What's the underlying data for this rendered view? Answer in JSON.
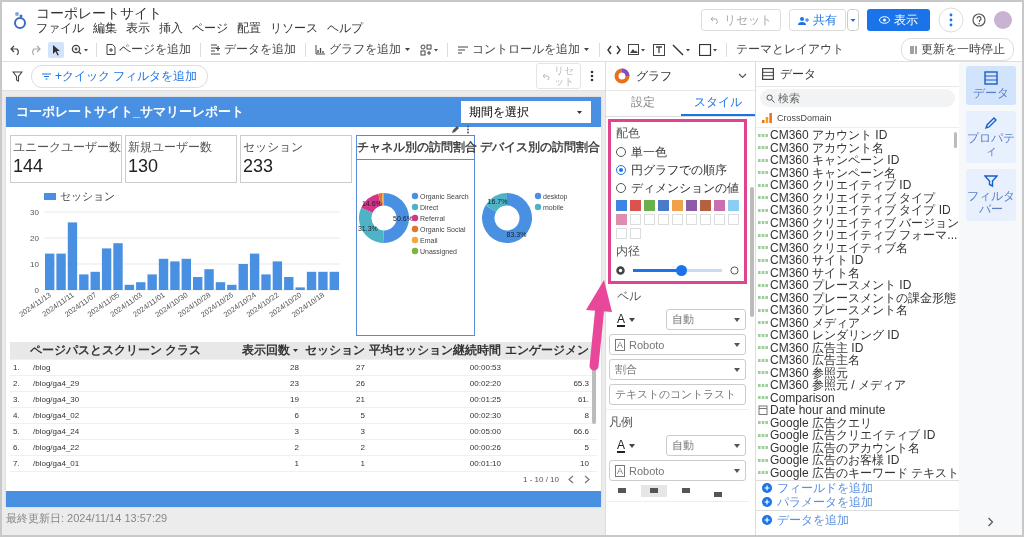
{
  "header": {
    "title": "コーポレートサイト",
    "menu": [
      "ファイル",
      "編集",
      "表示",
      "挿入",
      "ページ",
      "配置",
      "リソース",
      "ヘルプ"
    ],
    "reset": {
      "label": "リセット",
      "disabled": true
    },
    "share": "共有",
    "view": "表示"
  },
  "toolbar": {
    "pointer_selected": true,
    "add_page": "ページを追加",
    "add_data": "データを追加",
    "add_chart": "グラフを追加",
    "add_control": "コントロールを追加",
    "theme": "テーマとレイアウト",
    "pause": "更新を一時停止"
  },
  "filter_bar": {
    "quick_filter": "+クイック フィルタを追加",
    "reset": {
      "label": "リセット",
      "disabled": true
    }
  },
  "report": {
    "title": "コーポレートサイト_サマリーレポート",
    "date_picker": "期間を選択",
    "scorecards": [
      {
        "label": "ユニークユーザー数",
        "value": "144"
      },
      {
        "label": "新規ユーザー数",
        "value": "130"
      },
      {
        "label": "セッション",
        "value": "233"
      }
    ],
    "bar_chart": {
      "chart_data": {
        "type": "bar",
        "legend": "top",
        "ylim": [
          0,
          30
        ],
        "yticks": [
          0,
          10,
          20,
          30
        ],
        "categories": [
          "2024/11/13",
          null,
          "2024/11/11",
          null,
          "2024/11/07",
          null,
          "2024/11/05",
          null,
          "2024/11/03",
          null,
          "2024/11/01",
          null,
          "2024/10/30",
          null,
          "2024/10/28",
          null,
          "2024/10/26",
          null,
          "2024/10/24",
          null,
          "2024/10/22",
          null,
          "2024/10/20",
          null,
          "2024/10/18",
          null
        ],
        "series": [
          {
            "name": "セッション",
            "color": "#4a90e2",
            "values": [
              14,
              14,
              26,
              6,
              7,
              16,
              18,
              2,
              3,
              6,
              12,
              11,
              12,
              5,
              8,
              3,
              2,
              10,
              14,
              6,
              11,
              5,
              1,
              7,
              7,
              7
            ]
          }
        ]
      }
    },
    "donuts": [
      {
        "selected": true,
        "chart_data": {
          "type": "donut",
          "legend": "right",
          "title": "チャネル別の訪問割合",
          "categories": [
            "Organic Search",
            "Direct",
            "Referral",
            "Organic Social",
            "Email",
            "Unassigned"
          ],
          "values": [
            50.6,
            31.3,
            14.6,
            2.4,
            0.8,
            0.5
          ],
          "colors": [
            "#4a90e2",
            "#4fb3c8",
            "#d6338a",
            "#e0762c",
            "#f2a93b",
            "#7cb342"
          ],
          "value_labels": [
            "50.6%",
            "31.3%",
            "14.6%",
            null,
            null,
            null
          ]
        }
      },
      {
        "selected": false,
        "chart_data": {
          "type": "donut",
          "legend": "right",
          "title": "デバイス別の訪問割合",
          "categories": [
            "desktop",
            "mobile"
          ],
          "values": [
            83.3,
            16.7
          ],
          "colors": [
            "#4a90e2",
            "#4fb3c8"
          ],
          "value_labels": [
            "83.3%",
            "16.7%"
          ]
        }
      }
    ],
    "table": {
      "columns": [
        {
          "label": "ページパスとスクリーン クラス",
          "sorted": false
        },
        {
          "label": "表示回数",
          "sorted": true
        },
        {
          "label": "セッション",
          "sorted": false
        },
        {
          "label": "平均セッション継続時間",
          "sorted": false
        },
        {
          "label": "エンゲージメン",
          "sorted": false
        }
      ],
      "rows": [
        {
          "index": "1.",
          "cells": [
            "/blog",
            "28",
            "27",
            "00:00:53"
          ]
        },
        {
          "index": "2.",
          "cells": [
            "/blog/ga4_29",
            "23",
            "26",
            "00:02:20",
            "65.3"
          ]
        },
        {
          "index": "3.",
          "cells": [
            "/blog/ga4_30",
            "19",
            "21",
            "00:01:25",
            "61."
          ]
        },
        {
          "index": "4.",
          "cells": [
            "/blog/ga4_02",
            "6",
            "5",
            "00:02:30",
            "8"
          ]
        },
        {
          "index": "5.",
          "cells": [
            "/blog/ga4_24",
            "3",
            "3",
            "00:05:00",
            "66.6"
          ]
        },
        {
          "index": "6.",
          "cells": [
            "/blog/ga4_22",
            "2",
            "2",
            "00:00:26",
            "5"
          ]
        },
        {
          "index": "7.",
          "cells": [
            "/blog/ga4_01",
            "1",
            "1",
            "00:01:10",
            "10"
          ]
        }
      ],
      "pagination": "1 - 10 / 10"
    },
    "updated": "最終更新日: 2024/11/14 13:57:29"
  },
  "panel": {
    "title": "グラフ",
    "tabs": [
      {
        "label": "設定",
        "selected": false
      },
      {
        "label": "スタイル",
        "selected": true
      }
    ],
    "color_section": {
      "heading": "配色",
      "options": [
        {
          "label": "単一色",
          "selected": false
        },
        {
          "label": "円グラフでの順序",
          "selected": true
        },
        {
          "label": "ディメンションの値",
          "selected": false
        }
      ],
      "swatches": [
        {
          "kind": "color",
          "color": "#3d85e0"
        },
        {
          "kind": "color",
          "color": "#d9534f"
        },
        {
          "kind": "color",
          "color": "#6ab04c"
        },
        {
          "kind": "color",
          "color": "#4a7bc8"
        },
        {
          "kind": "color",
          "color": "#f0a24a"
        },
        {
          "kind": "color",
          "color": "#8e5ba8"
        },
        {
          "kind": "color",
          "color": "#b5613f"
        },
        {
          "kind": "color",
          "color": "#c96faf"
        },
        {
          "kind": "color",
          "color": "#8ccdf5"
        },
        {
          "kind": "color",
          "color": "#e08bb0"
        },
        {
          "kind": "empty"
        },
        {
          "kind": "empty"
        },
        {
          "kind": "empty"
        },
        {
          "kind": "empty"
        },
        {
          "kind": "empty"
        },
        {
          "kind": "empty"
        },
        {
          "kind": "empty"
        },
        {
          "kind": "empty"
        },
        {
          "kind": "empty"
        },
        {
          "kind": "empty"
        }
      ],
      "inner_radius": {
        "label": "内径",
        "level": 0.55
      }
    },
    "label_section": {
      "heading": "ベル",
      "glyph": "A",
      "color_mode": "自動",
      "font_glyph": "A",
      "font": "Roboto",
      "format": "割合",
      "contrast": "テキストのコントラスト"
    },
    "legend_section": {
      "heading": "凡例",
      "glyph": "A",
      "color_mode": "自動",
      "font_glyph": "A",
      "font": "Roboto",
      "alignment": [
        {
          "selected": false
        },
        {
          "selected": true
        },
        {
          "selected": false
        },
        {
          "selected": false
        }
      ]
    }
  },
  "data": {
    "title": "データ",
    "search_placeholder": "検索",
    "source": "CrossDomain",
    "fields": [
      {
        "name": "CM360 アカウント ID",
        "kind": "text"
      },
      {
        "name": "CM360 アカウント名",
        "kind": "text"
      },
      {
        "name": "CM360 キャンペーン ID",
        "kind": "text"
      },
      {
        "name": "CM360 キャンペーン名",
        "kind": "text"
      },
      {
        "name": "CM360 クリエイティブ ID",
        "kind": "text"
      },
      {
        "name": "CM360 クリエイティブ タイプ",
        "kind": "text"
      },
      {
        "name": "CM360 クリエイティブ タイプ ID",
        "kind": "text"
      },
      {
        "name": "CM360 クリエイティブ バージョン",
        "kind": "text"
      },
      {
        "name": "CM360 クリエイティブ フォーマ...",
        "kind": "text"
      },
      {
        "name": "CM360 クリエイティブ名",
        "kind": "text"
      },
      {
        "name": "CM360 サイト ID",
        "kind": "text"
      },
      {
        "name": "CM360 サイト名",
        "kind": "text"
      },
      {
        "name": "CM360 プレースメント ID",
        "kind": "text"
      },
      {
        "name": "CM360 プレースメントの課金形態",
        "kind": "text"
      },
      {
        "name": "CM360 プレースメント名",
        "kind": "text"
      },
      {
        "name": "CM360 メディア",
        "kind": "text"
      },
      {
        "name": "CM360 レンダリング ID",
        "kind": "text"
      },
      {
        "name": "CM360 広告主 ID",
        "kind": "text"
      },
      {
        "name": "CM360 広告主名",
        "kind": "text"
      },
      {
        "name": "CM360 参照元",
        "kind": "text"
      },
      {
        "name": "CM360 参照元 / メディア",
        "kind": "text"
      },
      {
        "name": "Comparison",
        "kind": "text"
      },
      {
        "name": "Date hour and minute",
        "kind": "date"
      },
      {
        "name": "Google 広告クエリ",
        "kind": "text"
      },
      {
        "name": "Google 広告クリエイティブ ID",
        "kind": "text"
      },
      {
        "name": "Google 広告のアカウント名",
        "kind": "text"
      },
      {
        "name": "Google 広告のお客様 ID",
        "kind": "text"
      },
      {
        "name": "Google 広告のキーワード テキスト",
        "kind": "text"
      }
    ],
    "add_field": "フィールドを追加",
    "add_param": "パラメータを追加",
    "add_data": "データを追加"
  },
  "rail": [
    {
      "label": "データ",
      "selected": true
    },
    {
      "label": "プロパティ",
      "selected": false
    },
    {
      "label": "フィルタバー",
      "selected": false
    }
  ]
}
